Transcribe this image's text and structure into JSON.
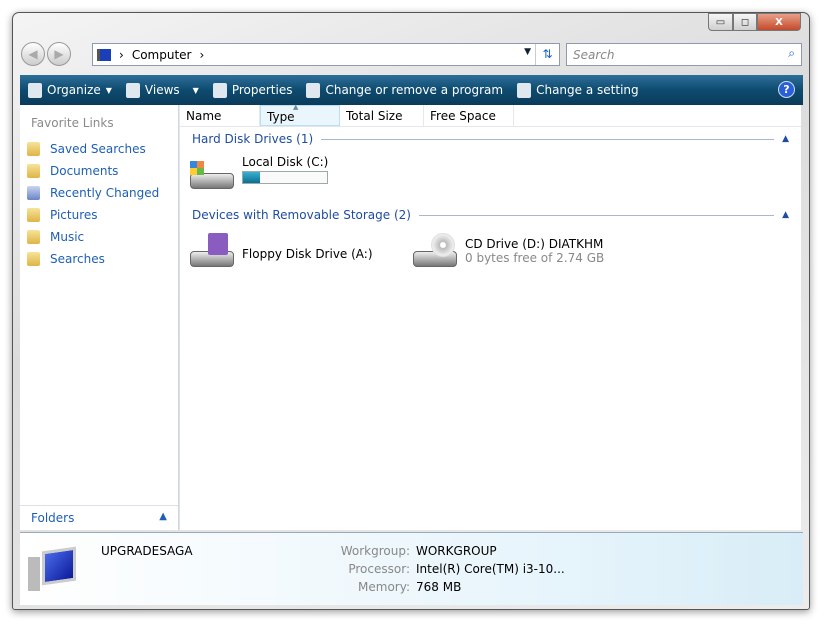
{
  "title_controls": {
    "minimize": "▭",
    "maximize": "◻",
    "close": "X"
  },
  "address": {
    "location": "Computer",
    "separator": "›"
  },
  "search": {
    "placeholder": "Search"
  },
  "toolbar": {
    "organize": "Organize",
    "views": "Views",
    "properties": "Properties",
    "change_program": "Change or remove a program",
    "change_setting": "Change a setting",
    "help": "?"
  },
  "sidebar": {
    "header": "Favorite Links",
    "items": [
      {
        "label": "Saved Searches"
      },
      {
        "label": "Documents"
      },
      {
        "label": "Recently Changed"
      },
      {
        "label": "Pictures"
      },
      {
        "label": "Music"
      },
      {
        "label": "Searches"
      }
    ],
    "folders": "Folders"
  },
  "columns": [
    "Name",
    "Type",
    "Total Size",
    "Free Space"
  ],
  "groups": [
    {
      "label": "Hard Disk Drives (1)",
      "items": [
        {
          "name": "Local Disk (C:)",
          "usage_fraction": 0.2
        }
      ]
    },
    {
      "label": "Devices with Removable Storage (2)",
      "items": [
        {
          "name": "Floppy Disk Drive (A:)"
        },
        {
          "name": "CD Drive (D:) DIATKHM",
          "detail": "0 bytes free of 2.74 GB"
        }
      ]
    }
  ],
  "details": {
    "computer_name": "UPGRADESAGA",
    "workgroup_label": "Workgroup:",
    "workgroup": "WORKGROUP",
    "processor_label": "Processor:",
    "processor": "Intel(R) Core(TM) i3-10...",
    "memory_label": "Memory:",
    "memory": "768 MB"
  }
}
